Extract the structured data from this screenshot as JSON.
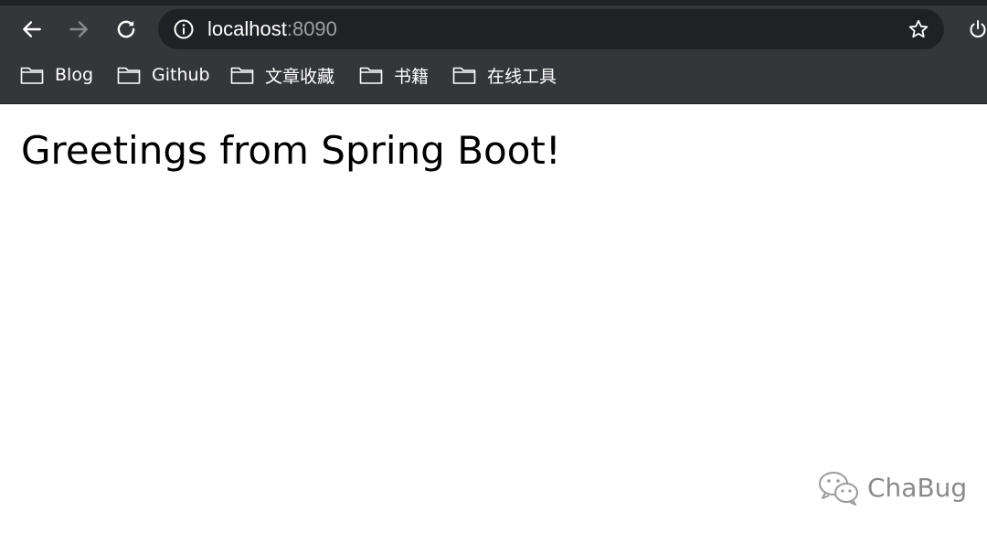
{
  "browser": {
    "url_host": "localhost",
    "url_port": ":8090",
    "bookmarks": [
      {
        "label": "Blog"
      },
      {
        "label": "Github"
      },
      {
        "label": "文章收藏"
      },
      {
        "label": "书籍"
      },
      {
        "label": "在线工具"
      }
    ],
    "icons": {
      "back": "back-arrow-icon",
      "forward": "forward-arrow-icon",
      "reload": "reload-icon",
      "info": "info-icon",
      "star": "star-icon",
      "power": "power-icon",
      "folder": "folder-icon"
    },
    "colors": {
      "toolbar": "#35363a",
      "omnibox": "#202124",
      "port_text": "#9aa0a6"
    }
  },
  "page": {
    "heading": "Greetings from Spring Boot!"
  },
  "watermark": {
    "text": "ChaBug"
  }
}
